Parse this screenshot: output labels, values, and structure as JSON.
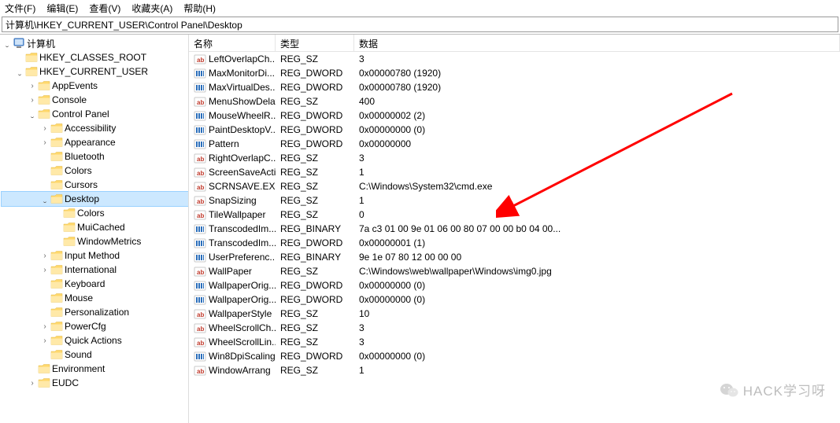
{
  "menubar": [
    "文件(F)",
    "编辑(E)",
    "查看(V)",
    "收藏夹(A)",
    "帮助(H)"
  ],
  "address": "计算机\\HKEY_CURRENT_USER\\Control Panel\\Desktop",
  "tree": {
    "root": "计算机",
    "hives": [
      {
        "name": "HKEY_CLASSES_ROOT",
        "children": false,
        "expanded": false
      },
      {
        "name": "HKEY_CURRENT_USER",
        "children": true,
        "expanded": true,
        "items": [
          {
            "name": "AppEvents",
            "children": true
          },
          {
            "name": "Console",
            "children": true
          },
          {
            "name": "Control Panel",
            "children": true,
            "expanded": true,
            "items": [
              {
                "name": "Accessibility",
                "children": true
              },
              {
                "name": "Appearance",
                "children": true
              },
              {
                "name": "Bluetooth",
                "children": false
              },
              {
                "name": "Colors",
                "children": false
              },
              {
                "name": "Cursors",
                "children": false
              },
              {
                "name": "Desktop",
                "children": true,
                "expanded": true,
                "selected": true,
                "items": [
                  {
                    "name": "Colors",
                    "children": false
                  },
                  {
                    "name": "MuiCached",
                    "children": false
                  },
                  {
                    "name": "WindowMetrics",
                    "children": false
                  }
                ]
              },
              {
                "name": "Input Method",
                "children": true
              },
              {
                "name": "International",
                "children": true
              },
              {
                "name": "Keyboard",
                "children": false
              },
              {
                "name": "Mouse",
                "children": false
              },
              {
                "name": "Personalization",
                "children": false
              },
              {
                "name": "PowerCfg",
                "children": true
              },
              {
                "name": "Quick Actions",
                "children": true
              },
              {
                "name": "Sound",
                "children": false
              }
            ]
          },
          {
            "name": "Environment",
            "children": false
          },
          {
            "name": "EUDC",
            "children": true
          }
        ]
      }
    ]
  },
  "columns": {
    "name": "名称",
    "type": "类型",
    "data": "数据"
  },
  "values": [
    {
      "name": "LeftOverlapCh...",
      "type": "REG_SZ",
      "data": "3",
      "icon": "sz"
    },
    {
      "name": "MaxMonitorDi...",
      "type": "REG_DWORD",
      "data": "0x00000780 (1920)",
      "icon": "dw"
    },
    {
      "name": "MaxVirtualDes...",
      "type": "REG_DWORD",
      "data": "0x00000780 (1920)",
      "icon": "dw"
    },
    {
      "name": "MenuShowDelay",
      "type": "REG_SZ",
      "data": "400",
      "icon": "sz"
    },
    {
      "name": "MouseWheelR...",
      "type": "REG_DWORD",
      "data": "0x00000002 (2)",
      "icon": "dw"
    },
    {
      "name": "PaintDesktopV...",
      "type": "REG_DWORD",
      "data": "0x00000000 (0)",
      "icon": "dw"
    },
    {
      "name": "Pattern",
      "type": "REG_DWORD",
      "data": "0x00000000",
      "icon": "dw"
    },
    {
      "name": "RightOverlapC...",
      "type": "REG_SZ",
      "data": "3",
      "icon": "sz"
    },
    {
      "name": "ScreenSaveActi...",
      "type": "REG_SZ",
      "data": "1",
      "icon": "sz"
    },
    {
      "name": "SCRNSAVE.EXE",
      "type": "REG_SZ",
      "data": "C:\\Windows\\System32\\cmd.exe",
      "icon": "sz"
    },
    {
      "name": "SnapSizing",
      "type": "REG_SZ",
      "data": "1",
      "icon": "sz"
    },
    {
      "name": "TileWallpaper",
      "type": "REG_SZ",
      "data": "0",
      "icon": "sz"
    },
    {
      "name": "TranscodedIm...",
      "type": "REG_BINARY",
      "data": "7a c3 01 00 9e 01 06 00 80 07 00 00 b0 04 00...",
      "icon": "dw"
    },
    {
      "name": "TranscodedIm...",
      "type": "REG_DWORD",
      "data": "0x00000001 (1)",
      "icon": "dw"
    },
    {
      "name": "UserPreferenc...",
      "type": "REG_BINARY",
      "data": "9e 1e 07 80 12 00 00 00",
      "icon": "dw"
    },
    {
      "name": "WallPaper",
      "type": "REG_SZ",
      "data": "C:\\Windows\\web\\wallpaper\\Windows\\img0.jpg",
      "icon": "sz"
    },
    {
      "name": "WallpaperOrig...",
      "type": "REG_DWORD",
      "data": "0x00000000 (0)",
      "icon": "dw"
    },
    {
      "name": "WallpaperOrig...",
      "type": "REG_DWORD",
      "data": "0x00000000 (0)",
      "icon": "dw"
    },
    {
      "name": "WallpaperStyle",
      "type": "REG_SZ",
      "data": "10",
      "icon": "sz"
    },
    {
      "name": "WheelScrollCh...",
      "type": "REG_SZ",
      "data": "3",
      "icon": "sz"
    },
    {
      "name": "WheelScrollLin...",
      "type": "REG_SZ",
      "data": "3",
      "icon": "sz"
    },
    {
      "name": "Win8DpiScaling",
      "type": "REG_DWORD",
      "data": "0x00000000 (0)",
      "icon": "dw"
    },
    {
      "name": "WindowArrang",
      "type": "REG_SZ",
      "data": "1",
      "icon": "sz"
    }
  ],
  "watermark": "HACK学习呀",
  "icons": {
    "expanded": "⌄",
    "collapsed": "›"
  }
}
